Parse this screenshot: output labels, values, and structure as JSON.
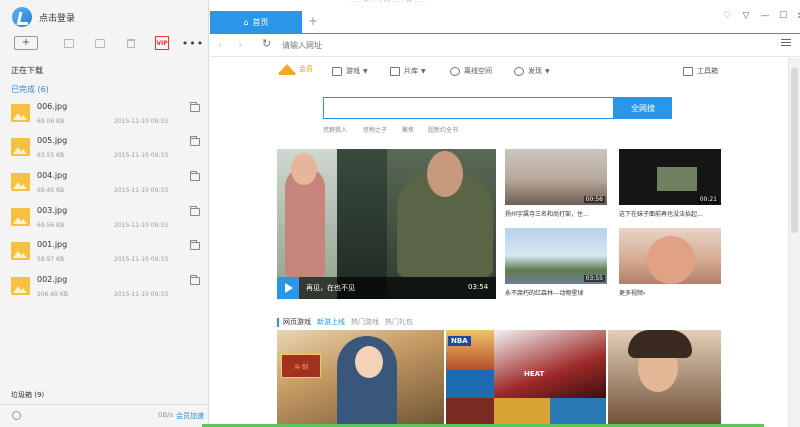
{
  "sidebar": {
    "login_label": "点击登录",
    "toolbar": {
      "new_label": "+",
      "vip_label": "VIP",
      "more_label": "•••"
    },
    "downloading_label": "正在下载",
    "completed_label": "已完成 (6)",
    "files": [
      {
        "name": "006.jpg",
        "size": "69.06 KB",
        "date": "2015-11-10 09:33"
      },
      {
        "name": "005.jpg",
        "size": "63.55 KB",
        "date": "2015-11-10 09:33"
      },
      {
        "name": "004.jpg",
        "size": "69.45 KB",
        "date": "2015-11-10 09:33"
      },
      {
        "name": "003.jpg",
        "size": "69.56 KB",
        "date": "2015-11-10 09:33"
      },
      {
        "name": "001.jpg",
        "size": "58.97 KB",
        "date": "2015-11-10 09:33"
      },
      {
        "name": "002.jpg",
        "size": "206.69 KB",
        "date": "2015-11-10 09:33"
      }
    ],
    "trash_label": "垃圾箱 (9)",
    "speed": "0B/s",
    "vip_speed_label": "会员加速"
  },
  "browser": {
    "top_strip_text": "...... 年 ... 小时 ...... 月 ......",
    "tab_home_label": "首页",
    "tab_add_label": "+",
    "url_placeholder": "请输入网址",
    "window_buttons": {
      "min": "—",
      "max": "☐",
      "close": "✕",
      "menu": "▽",
      "skin": "♡"
    }
  },
  "nav": {
    "vip": "会员",
    "games": "游戏",
    "movies": "片库",
    "offline": "离线空间",
    "discover": "发现",
    "tools": "工具箱"
  },
  "search": {
    "button_label": "全网搜",
    "hot_words": [
      "荒野猎人",
      "怪物之子",
      "聚焦",
      "超新约全书"
    ]
  },
  "videos": {
    "feature": {
      "title": "再见，在也不见",
      "duration": "03:54"
    },
    "items": [
      {
        "title": "扬州宇属寺三名和尚打架，住...",
        "duration": "00:56"
      },
      {
        "title": "这下在妹子面前再也没法抬起...",
        "duration": "00:21"
      },
      {
        "title": "永不腐朽的红森林---动物星球",
        "duration": "03:55"
      },
      {
        "title": "更多视频›",
        "duration": ""
      }
    ]
  },
  "games": {
    "title": "网页游戏",
    "tab_new": "新游上线",
    "tab_hot": "热门游戏",
    "tab_gift": "热门礼包",
    "g1_logo": "斗·剑",
    "g2_nba": "NBA",
    "g2_heat": "HEAT"
  },
  "colors": {
    "accent": "#2a96e8",
    "vip_gold": "#f5a623",
    "file_thumb": "#f6c042",
    "bottom_bar": "#5bc85b"
  }
}
